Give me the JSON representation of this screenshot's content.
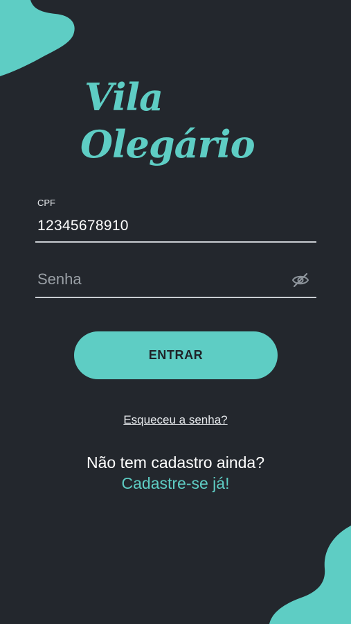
{
  "colors": {
    "background": "#23272d",
    "accent": "#5ecdc4",
    "text": "#ffffff",
    "muted": "#9aa0a6"
  },
  "logo": {
    "line1": "Vila",
    "line2": "Olegário"
  },
  "cpf": {
    "label": "CPF",
    "value": "12345678910"
  },
  "password": {
    "placeholder": "Senha",
    "toggle_icon": "eye-off-icon"
  },
  "actions": {
    "login_label": "ENTRAR",
    "forgot_password": "Esqueceu a senha?"
  },
  "signup": {
    "prompt": "Não tem cadastro ainda?",
    "link": "Cadastre-se já!"
  }
}
